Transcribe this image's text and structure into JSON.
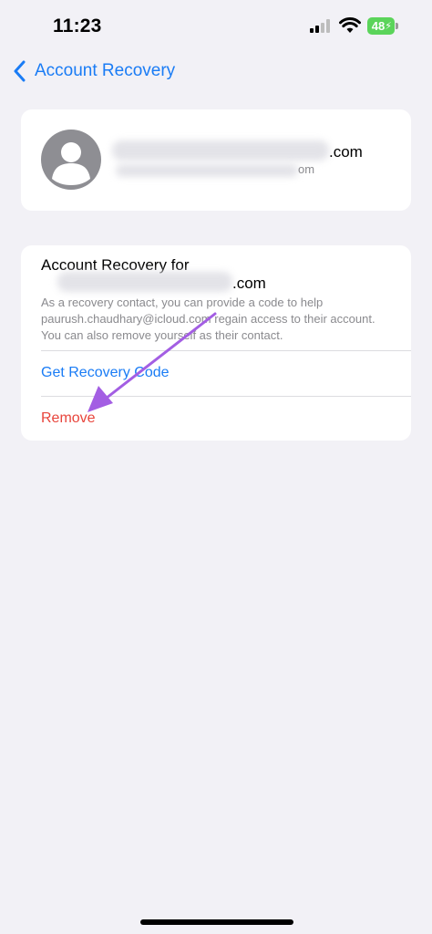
{
  "status_bar": {
    "time": "11:23",
    "battery": "48"
  },
  "nav": {
    "back_label": "Account Recovery"
  },
  "profile": {
    "email_visible": ".com",
    "email_sub_visible": "om"
  },
  "recovery": {
    "title_line1": "Account Recovery for",
    "title_line2_visible": ".com",
    "description": "As a recovery contact, you can provide a code to help paurush.chaudhary@icloud.com regain access to their account. You can also remove yourself as their contact.",
    "get_code_label": "Get Recovery Code",
    "remove_label": "Remove"
  },
  "colors": {
    "accent": "#1a7cf5",
    "destructive": "#e8453c",
    "annotation_arrow": "#a35ee3"
  }
}
